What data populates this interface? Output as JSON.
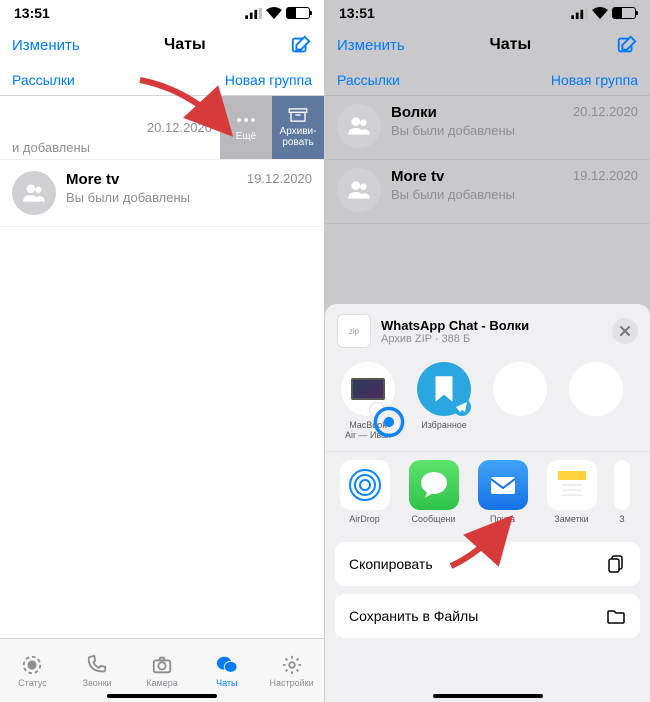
{
  "left": {
    "status": {
      "time": "13:51"
    },
    "nav": {
      "edit": "Изменить",
      "title": "Чаты"
    },
    "subbar": {
      "broadcasts": "Рассылки",
      "newgroup": "Новая группа"
    },
    "swiped": {
      "date": "20.12.2020",
      "sub_truncated": "и добавлены",
      "more": "Ещё",
      "archive": "Архиви-\nровать"
    },
    "chats": [
      {
        "name": "More tv",
        "sub": "Вы были добавлены",
        "date": "19.12.2020"
      }
    ],
    "tabs": {
      "status": "Статус",
      "calls": "Звонки",
      "camera": "Камера",
      "chats": "Чаты",
      "settings": "Настройки"
    }
  },
  "right": {
    "status": {
      "time": "13:51"
    },
    "nav": {
      "edit": "Изменить",
      "title": "Чаты"
    },
    "subbar": {
      "broadcasts": "Рассылки",
      "newgroup": "Новая группа"
    },
    "chats": [
      {
        "name": "Волки",
        "sub": "Вы были добавлены",
        "date": "20.12.2020"
      },
      {
        "name": "More tv",
        "sub": "Вы были добавлены",
        "date": "19.12.2020"
      }
    ],
    "sheet": {
      "zip_label": "zip",
      "title": "WhatsApp Chat - Волки",
      "sub": "Архив ZIP · 388 Б",
      "share": [
        {
          "label": "MacBook\nAir — Иван"
        },
        {
          "label": "Избранное"
        },
        {
          "label": ""
        },
        {
          "label": ""
        }
      ],
      "apps": [
        {
          "label": "AirDrop"
        },
        {
          "label": "Сообщени"
        },
        {
          "label": "Почта"
        },
        {
          "label": "Заметки"
        },
        {
          "label": "З"
        }
      ],
      "actions": [
        {
          "label": "Скопировать"
        },
        {
          "label": "Сохранить в Файлы"
        }
      ]
    }
  }
}
